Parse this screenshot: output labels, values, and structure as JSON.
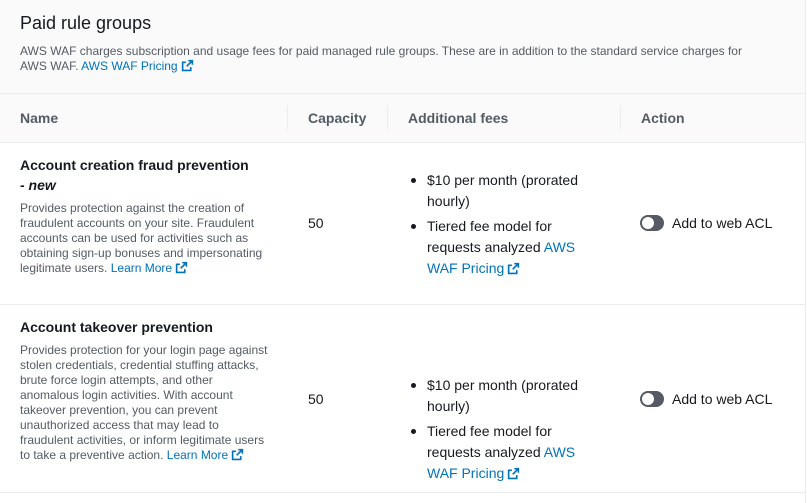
{
  "panel": {
    "title": "Paid rule groups",
    "description": "AWS WAF charges subscription and usage fees for paid managed rule groups. These are in addition to the standard service charges for AWS WAF.",
    "pricing_link": "AWS WAF Pricing"
  },
  "table": {
    "headers": {
      "name": "Name",
      "capacity": "Capacity",
      "fees": "Additional fees",
      "action": "Action"
    },
    "rows": [
      {
        "name": "Account creation fraud prevention",
        "name_suffix": "- new",
        "description": "Provides protection against the creation of fraudulent accounts on your site. Fraudulent accounts can be used for activities such as obtaining sign-up bonuses and impersonating legitimate users.",
        "learn_more_1": "Learn",
        "learn_more_2": "More",
        "capacity": "50",
        "fee_1": "$10 per month (prorated hourly)",
        "fee_2_prefix": "Tiered fee model for requests analyzed",
        "fee_2_link_1": "AWS",
        "fee_2_link_2": "WAF Pricing",
        "action_label": "Add to web ACL",
        "toggle_on": false
      },
      {
        "name": "Account takeover prevention",
        "description": "Provides protection for your login page against stolen credentials, credential stuffing attacks, brute force login attempts, and other anomalous login activities. With account takeover prevention, you can prevent unauthorized access that may lead to fraudulent activities, or inform legitimate users to take a preventive action.",
        "learn_more_1": "Learn",
        "learn_more_2": "More",
        "capacity": "50",
        "fee_1": "$10 per month (prorated hourly)",
        "fee_2_prefix": "Tiered fee model for requests analyzed",
        "fee_2_link_1": "AWS",
        "fee_2_link_2": "WAF Pricing",
        "action_label": "Add to web ACL",
        "toggle_on": false
      }
    ]
  },
  "colors": {
    "link": "#0073bb",
    "toggle_off": "#545b64",
    "header_bg": "#fafafa"
  }
}
